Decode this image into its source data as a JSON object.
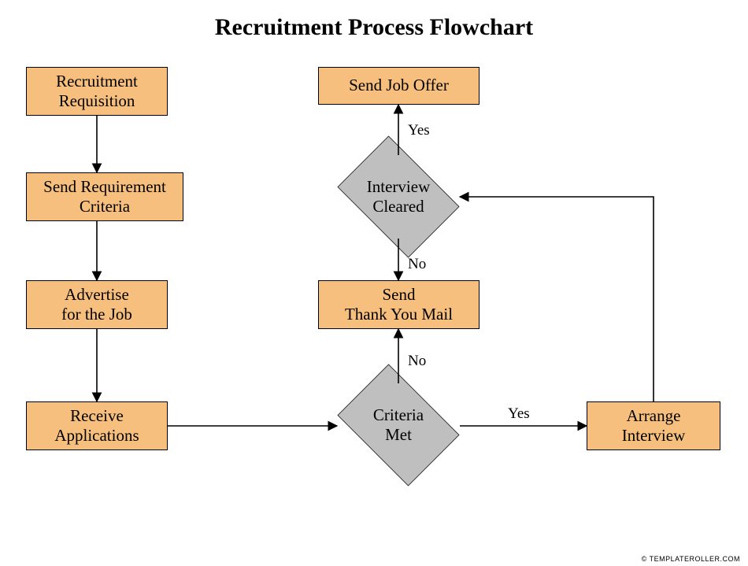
{
  "title": "Recruitment Process Flowchart",
  "footer": "© TEMPLATEROLLER.COM",
  "nodes": {
    "recruitment_requisition": "Recruitment\nRequisition",
    "send_requirement_criteria": "Send Requirement\nCriteria",
    "advertise_for_job": "Advertise\nfor the Job",
    "receive_applications": "Receive\nApplications",
    "send_job_offer": "Send Job Offer",
    "send_thank_you": "Send\nThank You Mail",
    "arrange_interview": "Arrange\nInterview"
  },
  "decisions": {
    "interview_cleared": "Interview\nCleared",
    "criteria_met": "Criteria\nMet"
  },
  "edge_labels": {
    "yes1": "Yes",
    "no1": "No",
    "no2": "No",
    "yes2": "Yes"
  },
  "colors": {
    "process_fill": "#f7bf7e",
    "decision_fill": "#bfbfbf",
    "stroke": "#000000"
  },
  "chart_data": {
    "type": "flowchart",
    "title": "Recruitment Process Flowchart",
    "nodes": [
      {
        "id": "n1",
        "type": "process",
        "label": "Recruitment Requisition"
      },
      {
        "id": "n2",
        "type": "process",
        "label": "Send Requirement Criteria"
      },
      {
        "id": "n3",
        "type": "process",
        "label": "Advertise for the Job"
      },
      {
        "id": "n4",
        "type": "process",
        "label": "Receive Applications"
      },
      {
        "id": "d1",
        "type": "decision",
        "label": "Criteria Met"
      },
      {
        "id": "n5",
        "type": "process",
        "label": "Send Thank You Mail"
      },
      {
        "id": "n6",
        "type": "process",
        "label": "Arrange Interview"
      },
      {
        "id": "d2",
        "type": "decision",
        "label": "Interview Cleared"
      },
      {
        "id": "n7",
        "type": "process",
        "label": "Send Job Offer"
      }
    ],
    "edges": [
      {
        "from": "n1",
        "to": "n2"
      },
      {
        "from": "n2",
        "to": "n3"
      },
      {
        "from": "n3",
        "to": "n4"
      },
      {
        "from": "n4",
        "to": "d1"
      },
      {
        "from": "d1",
        "to": "n6",
        "label": "Yes"
      },
      {
        "from": "d1",
        "to": "n5",
        "label": "No"
      },
      {
        "from": "n6",
        "to": "d2"
      },
      {
        "from": "d2",
        "to": "n7",
        "label": "Yes"
      },
      {
        "from": "d2",
        "to": "n5",
        "label": "No"
      }
    ]
  }
}
